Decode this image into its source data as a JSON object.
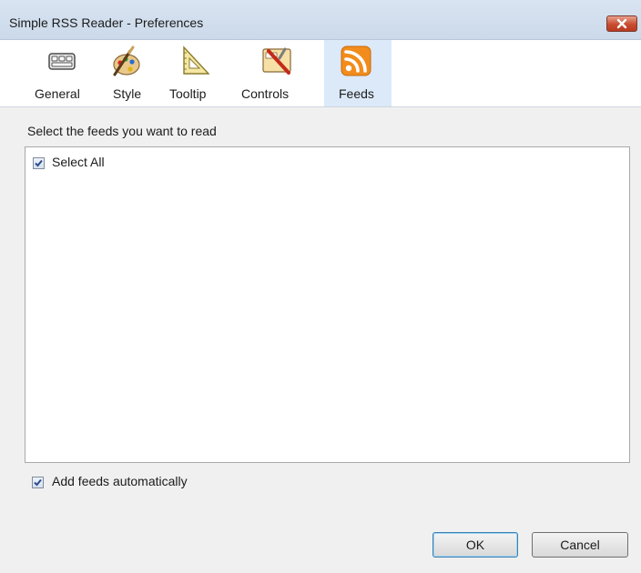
{
  "window": {
    "title": "Simple RSS Reader - Preferences"
  },
  "toolbar": {
    "tabs": [
      {
        "label": "General",
        "icon": "keyboard-icon"
      },
      {
        "label": "Style",
        "icon": "paint-palette-icon"
      },
      {
        "label": "Tooltip",
        "icon": "set-square-icon"
      },
      {
        "label": "Controls",
        "icon": "controls-tools-icon"
      },
      {
        "label": "Feeds",
        "icon": "rss-feed-icon",
        "selected": true
      }
    ]
  },
  "feeds": {
    "prompt": "Select the feeds you want to read",
    "select_all_label": "Select All",
    "select_all_checked": true,
    "add_auto_label": "Add feeds automatically",
    "add_auto_checked": true
  },
  "buttons": {
    "ok": "OK",
    "cancel": "Cancel"
  },
  "colors": {
    "rss_orange": "#f28c1c",
    "selected_tab_bg": "#dce9f8",
    "close_red": "#c84c30"
  }
}
